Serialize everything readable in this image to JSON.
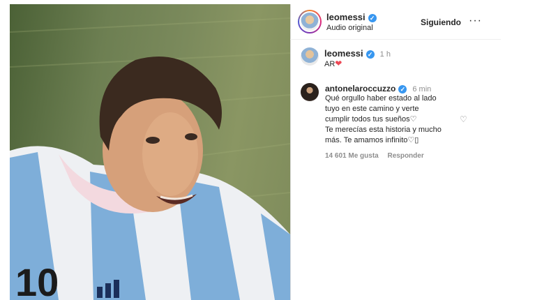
{
  "post": {
    "author": "leomessi",
    "audio": "Audio original",
    "follow_label": "Siguiendo",
    "more_label": "···",
    "caption_user": "leomessi",
    "caption_time": "1 h",
    "caption_text": "AR"
  },
  "comment": {
    "user": "antonelaroccuzzo",
    "time": "6 min",
    "text": "Qué orgullo haber estado al lado\ntuyo en este camino y verte\ncumplir todos tus sueños♡\nTe merecías esta historia y mucho\nmás. Te amamos infinito♡▯",
    "likes": "14 601 Me gusta",
    "reply_label": "Responder"
  },
  "icons": {
    "verified": "verified-badge-icon",
    "heart_red": "red-heart-emoji",
    "like": "heart-outline-icon"
  },
  "colors": {
    "verified_blue": "#3897f0",
    "heart_red": "#ed4956"
  }
}
